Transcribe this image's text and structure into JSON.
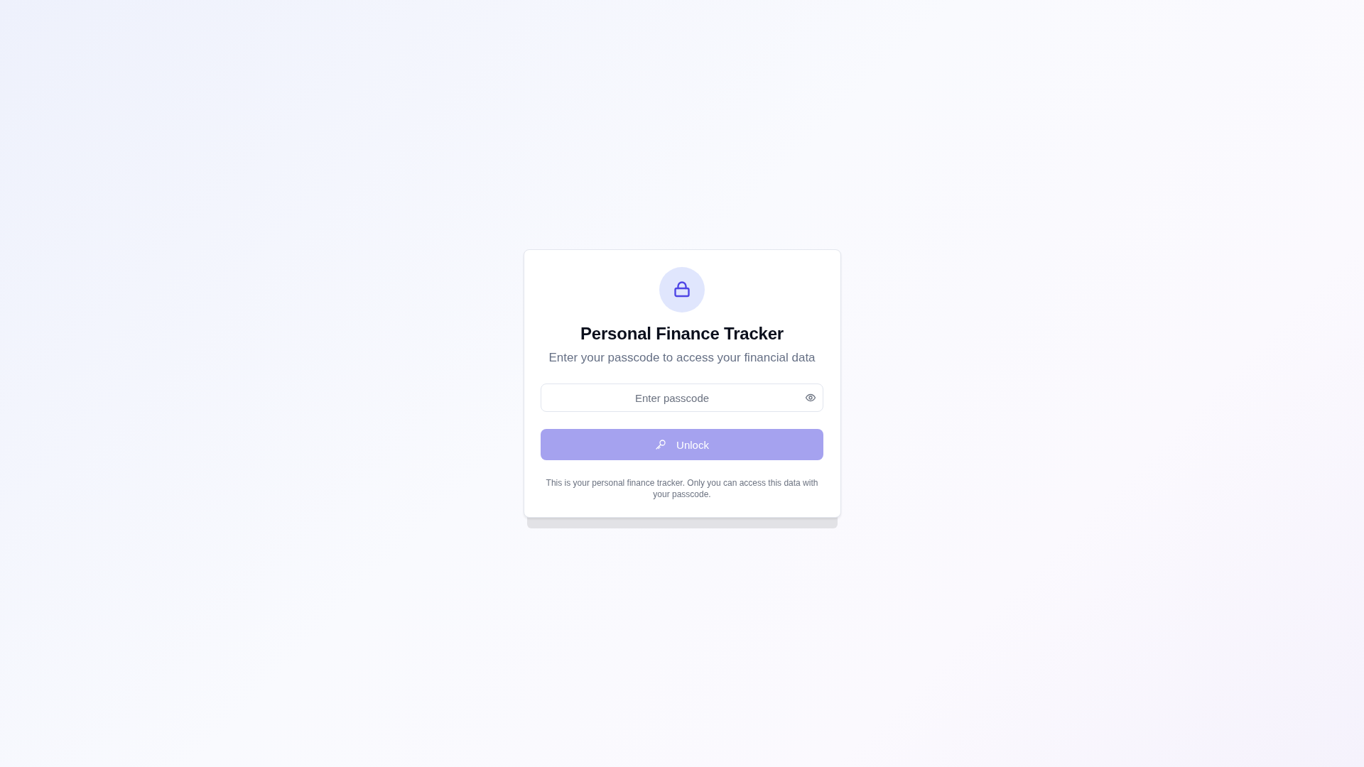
{
  "title": "Personal Finance Tracker",
  "subtitle": "Enter your passcode to access your financial data",
  "passcode_field": {
    "placeholder": "Enter passcode"
  },
  "unlock_button": {
    "label": "Unlock",
    "disabled": true
  },
  "footer_note": "This is your personal finance tracker. Only you can access this data with your passcode."
}
